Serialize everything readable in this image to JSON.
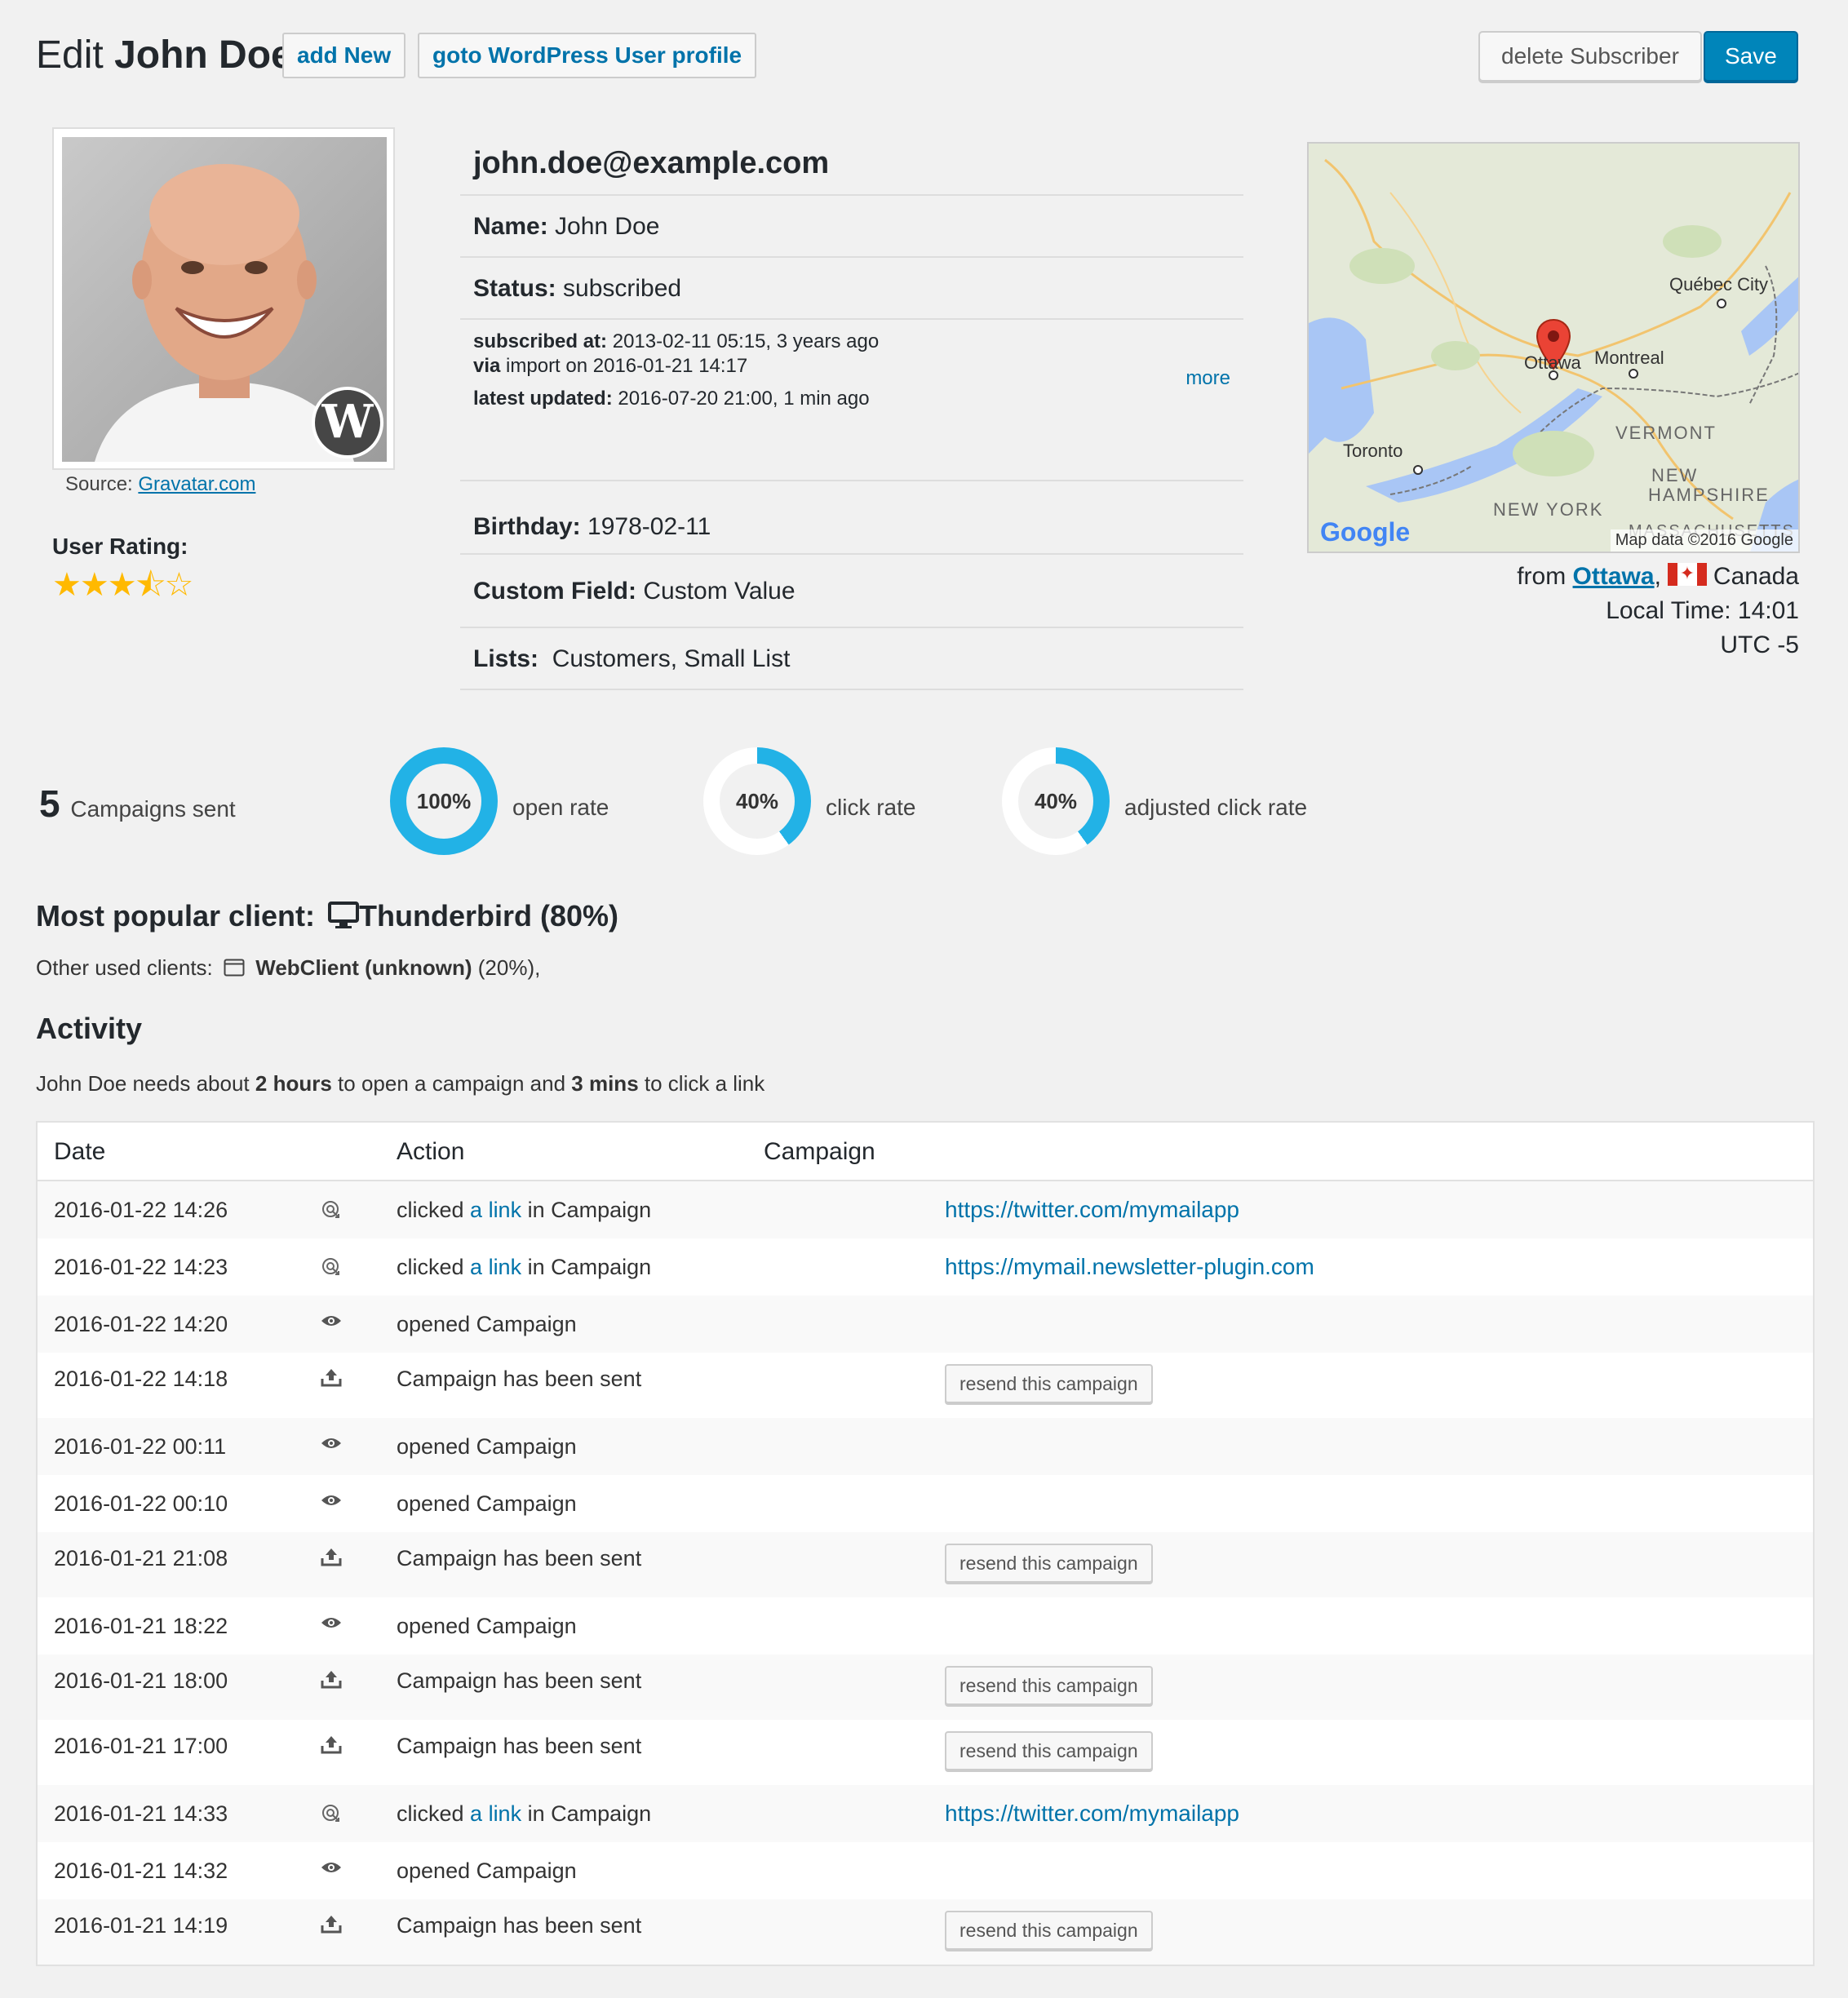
{
  "header": {
    "title_prefix": "Edit",
    "title_name": "John Doe",
    "add_new": "add New",
    "goto_profile": "goto WordPress User profile",
    "delete": "delete Subscriber",
    "save": "Save"
  },
  "avatar": {
    "source_label": "Source:",
    "source_link": "Gravatar.com"
  },
  "rating": {
    "label": "User Rating:",
    "stars": "★★★⯪☆",
    "value": 3.5,
    "max": 5
  },
  "info": {
    "email": "john.doe@example.com",
    "name_label": "Name:",
    "name": "John Doe",
    "status_label": "Status:",
    "status": "subscribed",
    "subscribed_label": "subscribed at:",
    "subscribed_value": "2013-02-11 05:15, 3 years ago",
    "via_label": "via",
    "via_value": "import on 2016-01-21 14:17",
    "updated_label": "latest updated:",
    "updated_value": "2016-07-20 21:00, 1 min ago",
    "more": "more",
    "birthday_label": "Birthday:",
    "birthday": "1978-02-11",
    "custom_label": "Custom Field:",
    "custom_value": "Custom Value",
    "lists_label": "Lists:",
    "lists_value": "Customers, Small List"
  },
  "map": {
    "labels": {
      "quebec": "Québec City",
      "ottawa": "Ottawa",
      "montreal": "Montreal",
      "toronto": "Toronto",
      "vermont": "VERMONT",
      "new": "NEW",
      "hampshire": "HAMPSHIRE",
      "newyork": "NEW YORK",
      "massachusetts": "MASSACHUSETTS"
    },
    "google": "Google",
    "attribution": "Map data ©2016 Google"
  },
  "geo": {
    "from": "from",
    "city": "Ottawa",
    "country": "Canada",
    "local_time": "Local Time: 14:01",
    "utc": "UTC -5"
  },
  "stats": {
    "campaigns_count": "5",
    "campaigns_label": "Campaigns sent",
    "open_rate_value": "100%",
    "open_rate_pct": 100,
    "open_rate_label": "open rate",
    "click_rate_value": "40%",
    "click_rate_pct": 40,
    "click_rate_label": "click rate",
    "adj_click_value": "40%",
    "adj_click_pct": 40,
    "adj_click_label": "adjusted click rate",
    "donut_color": "#22b2e6",
    "donut_track": "#ffffff"
  },
  "clients": {
    "popular_label": "Most popular client:",
    "popular_icon": "desktop-icon",
    "popular_value": "Thunderbird (80%)",
    "other_label": "Other used clients:",
    "other_icon": "browser-window-icon",
    "other_name": "WebClient (unknown)",
    "other_pct": "(20%),"
  },
  "activity": {
    "title": "Activity",
    "needs_prefix": "John Doe needs about",
    "open_time": "2 hours",
    "needs_middle": "to open a campaign and",
    "click_time": "3 mins",
    "needs_suffix": "to click a link"
  },
  "table": {
    "headers": {
      "date": "Date",
      "action": "Action",
      "campaign": "Campaign"
    },
    "link_text": "a link",
    "resend_label": "resend this campaign",
    "rows": [
      {
        "date": "2016-01-22 14:26",
        "type": "click",
        "icon": "click-icon",
        "pre": "clicked",
        "post": "in Campaign",
        "url": "https://twitter.com/mymailapp"
      },
      {
        "date": "2016-01-22 14:23",
        "type": "click",
        "icon": "click-icon",
        "pre": "clicked",
        "post": "in Campaign",
        "url": "https://mymail.newsletter-plugin.com"
      },
      {
        "date": "2016-01-22 14:20",
        "type": "open",
        "icon": "eye-icon",
        "action": "opened Campaign"
      },
      {
        "date": "2016-01-22 14:18",
        "type": "sent",
        "icon": "upload-icon",
        "action": "Campaign has been sent"
      },
      {
        "date": "2016-01-22 00:11",
        "type": "open",
        "icon": "eye-icon",
        "action": "opened Campaign"
      },
      {
        "date": "2016-01-22 00:10",
        "type": "open",
        "icon": "eye-icon",
        "action": "opened Campaign"
      },
      {
        "date": "2016-01-21 21:08",
        "type": "sent",
        "icon": "upload-icon",
        "action": "Campaign has been sent"
      },
      {
        "date": "2016-01-21 18:22",
        "type": "open",
        "icon": "eye-icon",
        "action": "opened Campaign"
      },
      {
        "date": "2016-01-21 18:00",
        "type": "sent",
        "icon": "upload-icon",
        "action": "Campaign has been sent"
      },
      {
        "date": "2016-01-21 17:00",
        "type": "sent",
        "icon": "upload-icon",
        "action": "Campaign has been sent"
      },
      {
        "date": "2016-01-21 14:33",
        "type": "click",
        "icon": "click-icon",
        "pre": "clicked",
        "post": "in Campaign",
        "url": "https://twitter.com/mymailapp"
      },
      {
        "date": "2016-01-21 14:32",
        "type": "open",
        "icon": "eye-icon",
        "action": "opened Campaign"
      },
      {
        "date": "2016-01-21 14:19",
        "type": "sent",
        "icon": "upload-icon",
        "action": "Campaign has been sent"
      }
    ]
  }
}
